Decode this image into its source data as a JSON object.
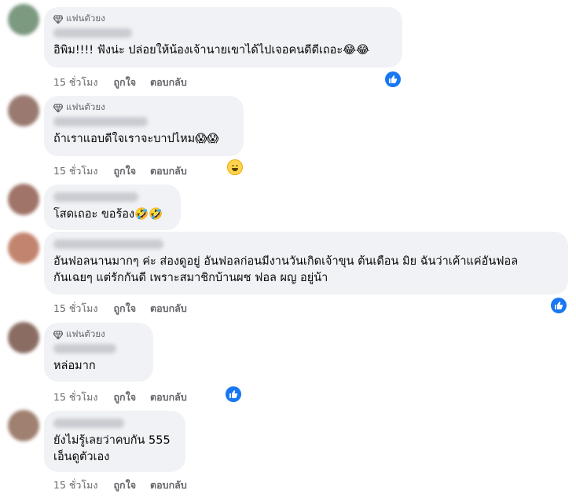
{
  "badge_label": "แฟนตัวยง",
  "actions": {
    "like": "ถูกใจ",
    "reply": "ตอบกลับ"
  },
  "comments": [
    {
      "text": "อิพิม!!!! ฟังน่ะ ปล่อยให้น้องเจ้านายเขาได้ไปเจอคนดีดีเถอะ😂😂",
      "time": "15 ชั่วโมง",
      "reaction": "like"
    },
    {
      "text": "ถ้าเราแอบดีใจเราจะบาปไหม😱😱",
      "time": "15 ชั่วโมง",
      "reaction": "haha"
    },
    {
      "text": "โสดเถอะ ขอร้อง🤣🤣",
      "time": "",
      "reaction": ""
    },
    {
      "text": "อันฟอลนานมากๆ ค่ะ ส่องดูอยู่ อันฟอลก่อนมีงานวันเกิดเจ้าขุน ต้นเดือน มิย ฉันว่าเค้าแค่อันฟอล\nกันเฉยๆ แต่รักกันดี เพราะสมาชิกบ้านผช ฟอล ผญ อยู่น้า",
      "time": "15 ชั่วโมง",
      "reaction": "like"
    },
    {
      "text": "หล่อมาก",
      "time": "15 ชั่วโมง",
      "reaction": "like"
    },
    {
      "text": "ยังไม่รู้เลยว่าคบกัน 555\nเอ็นดูตัวเอง",
      "time": "15 ชั่วโมง",
      "reaction": ""
    }
  ]
}
